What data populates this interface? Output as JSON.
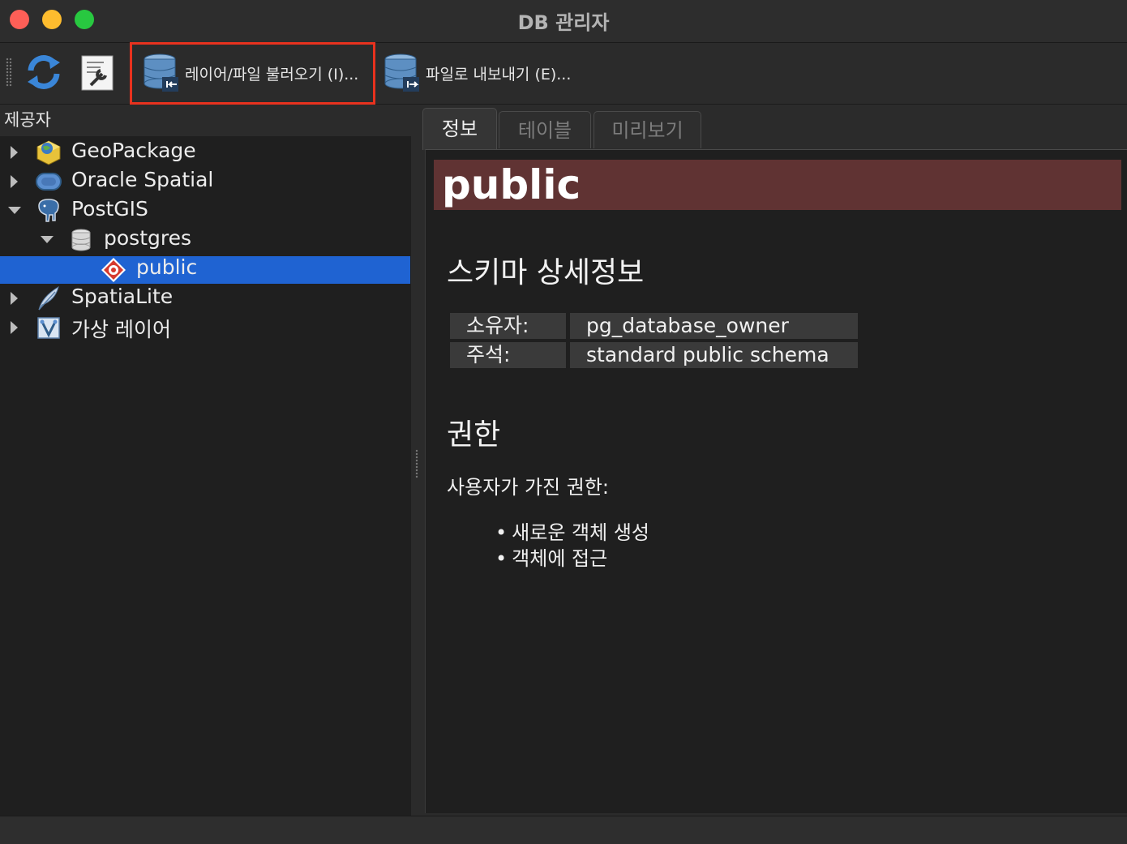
{
  "window": {
    "title": "DB 관리자"
  },
  "toolbar": {
    "import_label": "레이어/파일 불러오기 (I)...",
    "export_label": "파일로 내보내기 (E)..."
  },
  "providers": {
    "title": "제공자",
    "items": [
      {
        "label": "GeoPackage",
        "icon": "geopackage-icon",
        "expanded": false
      },
      {
        "label": "Oracle Spatial",
        "icon": "oracle-icon",
        "expanded": false
      },
      {
        "label": "PostGIS",
        "icon": "postgis-elephant-icon",
        "expanded": true
      },
      {
        "label": "postgres",
        "icon": "database-icon",
        "expanded": true
      },
      {
        "label": "public",
        "icon": "schema-icon",
        "selected": true
      },
      {
        "label": "SpatiaLite",
        "icon": "spatialite-feather-icon",
        "expanded": false
      },
      {
        "label": "가상 레이어",
        "icon": "virtual-layer-icon",
        "expanded": false
      }
    ]
  },
  "tabs": [
    {
      "label": "정보",
      "active": true
    },
    {
      "label": "테이블",
      "active": false
    },
    {
      "label": "미리보기",
      "active": false
    }
  ],
  "info": {
    "banner": "public",
    "section_schema": "스키마 상세정보",
    "owner_key": "소유자:",
    "owner_value": "pg_database_owner",
    "comment_key": "주석:",
    "comment_value": "standard public schema",
    "section_privileges": "권한",
    "privileges_intro": "사용자가 가진 권한:",
    "privileges": [
      "새로운 객체 생성",
      "객체에 접근"
    ]
  },
  "colors": {
    "selection": "#1f63d2",
    "banner": "#603333",
    "highlight": "#e8321e"
  }
}
